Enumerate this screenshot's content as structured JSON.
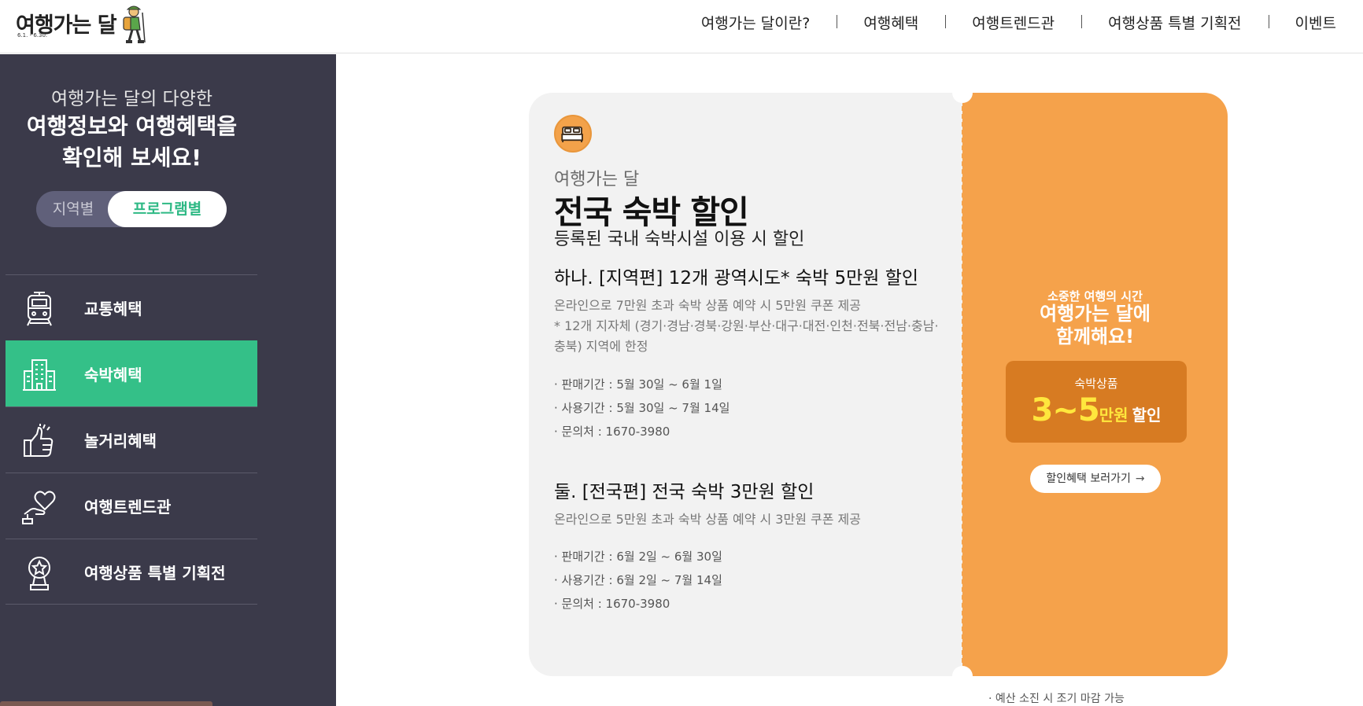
{
  "header": {
    "logo_text": "여행가는 달",
    "logo_date": "6.1. - 6.30.",
    "nav": [
      "여행가는 달이란?",
      "여행혜택",
      "여행트렌드관",
      "여행상품 특별 기획전",
      "이벤트"
    ]
  },
  "sidebar": {
    "intro_line1": "여행가는 달의 다양한",
    "intro_line2": "여행정보와 여행혜택을",
    "intro_line3": "확인해 보세요!",
    "toggle": {
      "off_label": "지역별",
      "on_label": "프로그램별"
    },
    "menu": [
      {
        "label": "교통혜택",
        "icon": "train-icon",
        "active": false
      },
      {
        "label": "숙박혜택",
        "icon": "building-icon",
        "active": true
      },
      {
        "label": "놀거리혜택",
        "icon": "thumbs-up-icon",
        "active": false
      },
      {
        "label": "여행트렌드관",
        "icon": "heart-hand-icon",
        "active": false
      },
      {
        "label": "여행상품 특별 기획전",
        "icon": "award-icon",
        "active": false
      }
    ]
  },
  "coupon": {
    "icon": "bed-icon",
    "kicker": "여행가는 달",
    "title": "전국 숙박 할인",
    "subtitle": "등록된 국내 숙박시설 이용 시 할인",
    "section1": {
      "title": "하나. [지역편] 12개 광역시도* 숙박 5만원 할인",
      "desc1": "온라인으로 7만원 초과 숙박 상품 예약 시 5만원 쿠폰 제공",
      "desc2": "* 12개 지자체 (경기·경남·경북·강원·부산·대구·대전·인천·전북·전남·충남·충북) 지역에 한정",
      "sale_period": "· 판매기간 : 5월 30일 ~ 6월 1일",
      "use_period": "· 사용기간 : 5월 30일 ~ 7월 14일",
      "contact": "· 문의처 : 1670-3980"
    },
    "section2": {
      "title": "둘. [전국편] 전국 숙박 3만원 할인",
      "desc1": "온라인으로 5만원 초과 숙박 상품 예약 시 3만원 쿠폰 제공",
      "sale_period": "· 판매기간 : 6월 2일 ~ 6월 30일",
      "use_period": "· 사용기간 : 6월 2일 ~ 7월 14일",
      "contact": "· 문의처 : 1670-3980"
    },
    "right": {
      "kicker": "소중한 여행의 시간",
      "title_line1": "여행가는 달에",
      "title_line2": "함께해요!",
      "box_label": "숙박상품",
      "box_number": "3~5",
      "box_unit": "만원",
      "box_discount": "할인",
      "button_label": "할인혜택 보러가기",
      "button_arrow": "→"
    },
    "footnote": "· 예산 소진 시 조기 마감 가능"
  },
  "colors": {
    "sidebar_bg": "#3b3a4a",
    "active_green": "#34c088",
    "coupon_orange": "#f5a24b",
    "coupon_box": "#d77b22",
    "highlight_yellow": "#ffe73d"
  }
}
